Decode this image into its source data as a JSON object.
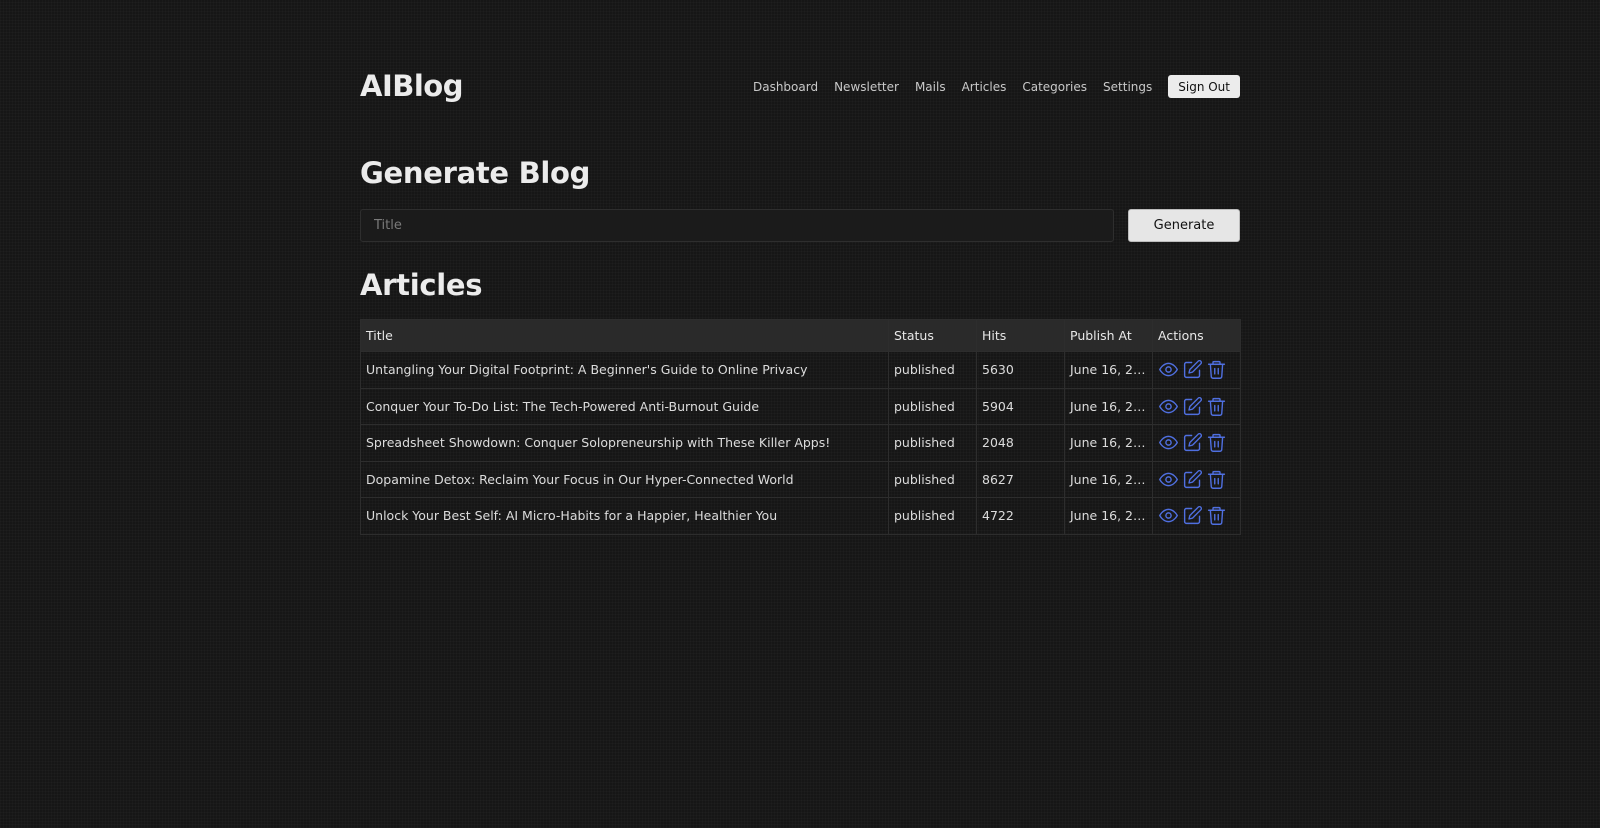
{
  "brand": "AIBlog",
  "nav": {
    "links": [
      "Dashboard",
      "Newsletter",
      "Mails",
      "Articles",
      "Categories",
      "Settings"
    ],
    "signout": "Sign Out"
  },
  "generate": {
    "heading": "Generate Blog",
    "placeholder": "Title",
    "button": "Generate"
  },
  "articles": {
    "heading": "Articles",
    "columns": [
      "Title",
      "Status",
      "Hits",
      "Publish At",
      "Actions"
    ],
    "rows": [
      {
        "title": "Untangling Your Digital Footprint: A Beginner's Guide to Online Privacy",
        "status": "published",
        "hits": "5630",
        "publish_at": "June 16, 20..."
      },
      {
        "title": "Conquer Your To-Do List: The Tech-Powered Anti-Burnout Guide",
        "status": "published",
        "hits": "5904",
        "publish_at": "June 16, 20..."
      },
      {
        "title": "Spreadsheet Showdown: Conquer Solopreneurship with These Killer Apps!",
        "status": "published",
        "hits": "2048",
        "publish_at": "June 16, 20..."
      },
      {
        "title": "Dopamine Detox: Reclaim Your Focus in Our Hyper-Connected World",
        "status": "published",
        "hits": "8627",
        "publish_at": "June 16, 20..."
      },
      {
        "title": "Unlock Your Best Self: AI Micro-Habits for a Happier, Healthier You",
        "status": "published",
        "hits": "4722",
        "publish_at": "June 16, 20..."
      }
    ],
    "action_icons": [
      "eye-icon",
      "edit-icon",
      "trash-icon"
    ]
  },
  "colors": {
    "background": "#161616",
    "accent_icon": "#4f6fe0",
    "button_bg": "#e6e6e6",
    "table_header_bg": "#2a2a2a"
  }
}
